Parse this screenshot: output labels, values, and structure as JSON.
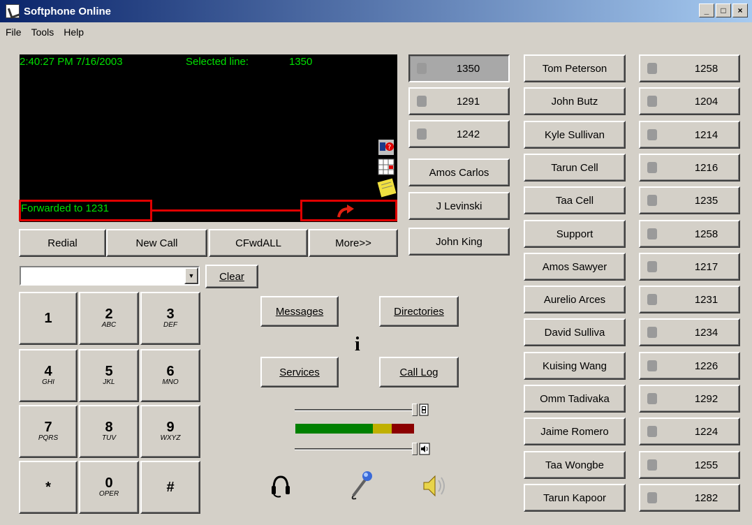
{
  "window": {
    "title": "Softphone Online",
    "minimize": "_",
    "maximize": "□",
    "close": "×"
  },
  "menu": {
    "file": "File",
    "tools": "Tools",
    "help": "Help"
  },
  "display": {
    "datetime": "2:40:27 PM 7/16/2003",
    "selected_label": "Selected line:",
    "selected_value": "1350",
    "forwarded": "Forwarded to 1231"
  },
  "softkeys": [
    "Redial",
    "New Call",
    "CFwdALL",
    "More>>"
  ],
  "clear_label": "Clear",
  "dial_input": {
    "value": "",
    "placeholder": ""
  },
  "keypad": [
    {
      "digit": "1",
      "letters": ""
    },
    {
      "digit": "2",
      "letters": "ABC"
    },
    {
      "digit": "3",
      "letters": "DEF"
    },
    {
      "digit": "4",
      "letters": "GHI"
    },
    {
      "digit": "5",
      "letters": "JKL"
    },
    {
      "digit": "6",
      "letters": "MNO"
    },
    {
      "digit": "7",
      "letters": "PQRS"
    },
    {
      "digit": "8",
      "letters": "TUV"
    },
    {
      "digit": "9",
      "letters": "WXYZ"
    },
    {
      "digit": "*",
      "letters": ""
    },
    {
      "digit": "0",
      "letters": "OPER"
    },
    {
      "digit": "#",
      "letters": ""
    }
  ],
  "features": {
    "messages": "Messages",
    "directories": "Directories",
    "services": "Services",
    "call_log": "Call Log",
    "info": "i"
  },
  "lines": [
    {
      "label": "1350",
      "led": true,
      "selected": true
    },
    {
      "label": "1291",
      "led": true
    },
    {
      "label": "1242",
      "led": true
    },
    {
      "label": "Amos Carlos",
      "led": false
    },
    {
      "label": "J Levinski",
      "led": false
    },
    {
      "label": "John King",
      "led": false
    }
  ],
  "speed_dials": [
    {
      "name": "Tom Peterson",
      "ext": "1258"
    },
    {
      "name": "John Butz",
      "ext": "1204"
    },
    {
      "name": "Kyle Sullivan",
      "ext": "1214"
    },
    {
      "name": "Tarun Cell",
      "ext": "1216"
    },
    {
      "name": "Taa Cell",
      "ext": "1235"
    },
    {
      "name": "Support",
      "ext": "1258"
    },
    {
      "name": "Amos Sawyer",
      "ext": "1217"
    },
    {
      "name": "Aurelio Arces",
      "ext": "1231"
    },
    {
      "name": "David Sulliva",
      "ext": "1234"
    },
    {
      "name": "Kuising Wang",
      "ext": "1226"
    },
    {
      "name": "Omm Tadivaka",
      "ext": "1292"
    },
    {
      "name": "Jaime Romero",
      "ext": "1224"
    },
    {
      "name": "Taa Wongbe",
      "ext": "1255"
    },
    {
      "name": "Tarun Kapoor",
      "ext": "1282"
    }
  ],
  "audio": {
    "mic_level": 1.0,
    "speaker_level": 1.0,
    "vu_green": 0.65,
    "vu_yellow": 0.16,
    "vu_red": 0.19
  },
  "colors": {
    "screen_bg": "#000000",
    "screen_text": "#00e000",
    "highlight": "#e00000",
    "vu_green": "#008000",
    "vu_yellow": "#c0b000",
    "vu_red": "#8b0000"
  }
}
